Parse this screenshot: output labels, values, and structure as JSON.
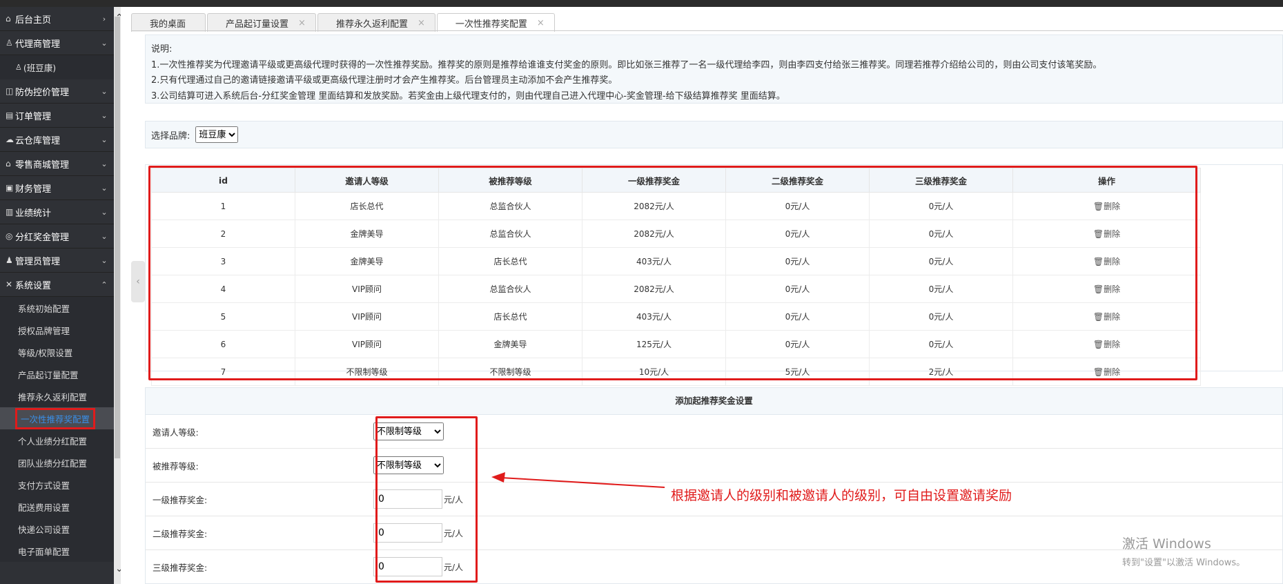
{
  "sidebar": {
    "items": [
      {
        "label": "后台主页",
        "icon": "home-icon",
        "chev": "›"
      },
      {
        "label": "代理商管理",
        "icon": "user-icon",
        "chev": "⌄"
      },
      {
        "label": "防伪控价管理",
        "icon": "shield-icon",
        "chev": "⌄"
      },
      {
        "label": "订单管理",
        "icon": "order-icon",
        "chev": "⌄"
      },
      {
        "label": "云仓库管理",
        "icon": "cloud-icon",
        "chev": "⌄"
      },
      {
        "label": "零售商城管理",
        "icon": "shop-icon",
        "chev": "⌄"
      },
      {
        "label": "财务管理",
        "icon": "finance-icon",
        "chev": "⌄"
      },
      {
        "label": "业绩统计",
        "icon": "chart-icon",
        "chev": "⌄"
      },
      {
        "label": "分红奖金管理",
        "icon": "bonus-icon",
        "chev": "⌄"
      },
      {
        "label": "管理员管理",
        "icon": "admin-icon",
        "chev": "⌄"
      },
      {
        "label": "系统设置",
        "icon": "settings-icon",
        "chev": "⌃"
      }
    ],
    "agent_sub": "(班豆康)",
    "settings_sub": [
      "系统初始配置",
      "授权品牌管理",
      "等级/权限设置",
      "产品起订量配置",
      "推荐永久返利配置",
      "一次性推荐奖配置",
      "个人业绩分红配置",
      "团队业绩分红配置",
      "支付方式设置",
      "配送费用设置",
      "快递公司设置",
      "电子面单配置"
    ]
  },
  "tabs": [
    {
      "label": "我的桌面",
      "close": ""
    },
    {
      "label": "产品起订量设置",
      "close": "×"
    },
    {
      "label": "推荐永久返利配置",
      "close": "×"
    },
    {
      "label": "一次性推荐奖配置",
      "close": "×"
    }
  ],
  "description": {
    "title": "说明:",
    "lines": [
      "1.一次性推荐奖为代理邀请平级或更高级代理时获得的一次性推荐奖励。推荐奖的原则是推荐给谁谁支付奖金的原则。即比如张三推荐了一名一级代理给李四，则由李四支付给张三推荐奖。同理若推荐介绍给公司的，则由公司支付该笔奖励。",
      "2.只有代理通过自己的邀请链接邀请平级或更高级代理注册时才会产生推荐奖。后台管理员主动添加不会产生推荐奖。",
      "3.公司结算可进入系统后台-分红奖金管理 里面结算和发放奖励。若奖金由上级代理支付的，则由代理自己进入代理中心-奖金管理-给下级结算推荐奖 里面结算。"
    ]
  },
  "brand": {
    "label": "选择品牌:",
    "value": "班豆康"
  },
  "table": {
    "headers": [
      "id",
      "邀请人等级",
      "被推荐等级",
      "一级推荐奖金",
      "二级推荐奖金",
      "三级推荐奖金",
      "操作"
    ],
    "rows": [
      [
        "1",
        "店长总代",
        "总监合伙人",
        "2082元/人",
        "0元/人",
        "0元/人",
        "删除"
      ],
      [
        "2",
        "金牌美导",
        "总监合伙人",
        "2082元/人",
        "0元/人",
        "0元/人",
        "删除"
      ],
      [
        "3",
        "金牌美导",
        "店长总代",
        "403元/人",
        "0元/人",
        "0元/人",
        "删除"
      ],
      [
        "4",
        "VIP顾问",
        "总监合伙人",
        "2082元/人",
        "0元/人",
        "0元/人",
        "删除"
      ],
      [
        "5",
        "VIP顾问",
        "店长总代",
        "403元/人",
        "0元/人",
        "0元/人",
        "删除"
      ],
      [
        "6",
        "VIP顾问",
        "金牌美导",
        "125元/人",
        "0元/人",
        "0元/人",
        "删除"
      ],
      [
        "7",
        "不限制等级",
        "不限制等级",
        "10元/人",
        "5元/人",
        "2元/人",
        "删除"
      ]
    ]
  },
  "form": {
    "title": "添加起推荐奖金设置",
    "inviter_label": "邀请人等级:",
    "inviter_value": "不限制等级",
    "invitee_label": "被推荐等级:",
    "invitee_value": "不限制等级",
    "level1_label": "一级推荐奖金:",
    "level1_value": "0",
    "level2_label": "二级推荐奖金:",
    "level2_value": "0",
    "level3_label": "三级推荐奖金:",
    "level3_value": "0",
    "unit": "元/人"
  },
  "annotation": "根据邀请人的级别和被邀请人的级别，可自由设置邀请奖励",
  "watermark": {
    "line1": "激活 Windows",
    "line2": "转到\"设置\"以激活 Windows。"
  },
  "colors": {
    "highlight_red": "#e01b1b",
    "sidebar_bg": "#2f3136",
    "active_link": "#3a8ee6"
  }
}
